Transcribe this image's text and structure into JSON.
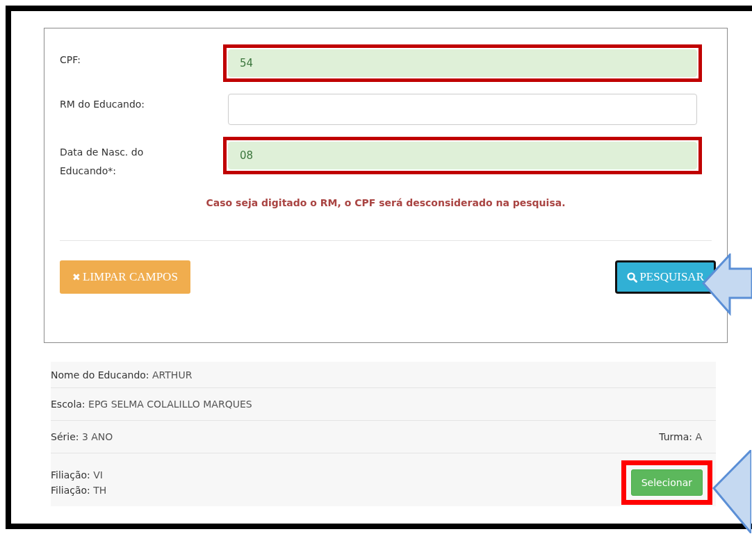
{
  "form": {
    "fields": [
      {
        "label": "CPF:",
        "value": "54",
        "highlighted": true
      },
      {
        "label": "RM do Educando:",
        "highlighted": false
      },
      {
        "label": "Data de Nasc. do Educando*:",
        "value": "08",
        "highlighted": true
      }
    ],
    "message": "Caso seja digitado o RM, o CPF será desconsiderado na pesquisa.",
    "clear_button": {
      "icon": "✖",
      "label": "LIMPAR CAMPOS"
    },
    "search_button": {
      "label": "PESQUISAR",
      "focused": true
    }
  },
  "result": {
    "rows": [
      {
        "kind": "single",
        "items": [
          {
            "label": "Nome do Educando:",
            "value": "ARTHUR"
          }
        ]
      },
      {
        "kind": "single",
        "items": [
          {
            "label": "Escola:",
            "value": "EPG SELMA COLALILLO MARQUES"
          }
        ]
      },
      {
        "kind": "split",
        "items": [
          {
            "label": "Série:",
            "value": "3 ANO"
          },
          {
            "label": "Turma:",
            "value": "A"
          }
        ]
      },
      {
        "kind": "parents",
        "items": [
          {
            "label": "Filiação:",
            "value": "VI"
          },
          {
            "label": "Filiação:",
            "value": "TH"
          }
        ]
      }
    ],
    "select_button": {
      "label": "Selecionar",
      "highlighted": true
    }
  }
}
